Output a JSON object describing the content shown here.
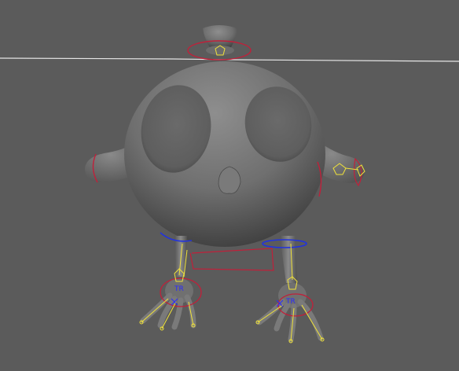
{
  "viewport": {
    "background": "#5b5b5b",
    "horizon_color": "#e6e6e6",
    "model_color": "#7a7a7a",
    "ik_color": "#f0e23a",
    "nurbs_red": "#c0203a",
    "nurbs_blue": "#2233dd"
  },
  "labels": {
    "left_foot_tr": "TR",
    "right_foot_tr": "TR"
  }
}
